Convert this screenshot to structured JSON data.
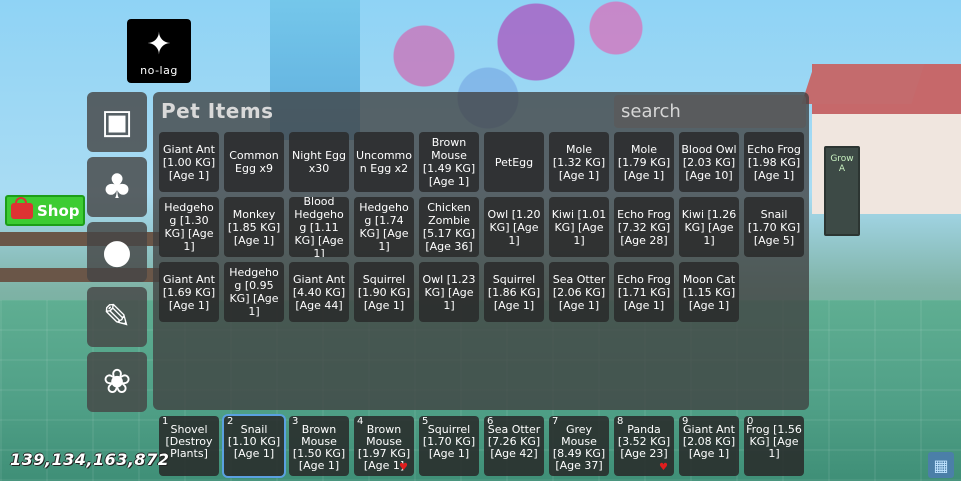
{
  "logo": {
    "text": "no-lag",
    "icon": "butterfly-icon"
  },
  "shop": {
    "label": "Shop",
    "icon": "basket-icon"
  },
  "side_menu": [
    {
      "icon": "box-icon",
      "glyph": "▣"
    },
    {
      "icon": "sprout-icon",
      "glyph": "🌱"
    },
    {
      "icon": "tomato-icon",
      "glyph": "🍅"
    },
    {
      "icon": "wrench-icon",
      "glyph": "🔧"
    },
    {
      "icon": "paw-icon",
      "glyph": "🐾"
    }
  ],
  "panel": {
    "title": "Pet Items",
    "search_placeholder": "search",
    "items": [
      "Giant Ant [1.00 KG] [Age 1]",
      "Common Egg x9",
      "Night Egg x30",
      "Uncommon Egg x2",
      "Brown Mouse [1.49 KG] [Age 1]",
      "PetEgg",
      "Mole [1.32 KG] [Age 1]",
      "Mole [1.79 KG] [Age 1]",
      "Blood Owl [2.03 KG] [Age 10]",
      "Echo Frog [1.98 KG] [Age 1]",
      "Hedgehog [1.30 KG] [Age 1]",
      "Monkey [1.85 KG] [Age 1]",
      "Blood Hedgehog [1.11 KG] [Age 1]",
      "Hedgehog [1.74 KG] [Age 1]",
      "Chicken Zombie [5.17 KG] [Age 36]",
      "Owl [1.20 KG] [Age 1]",
      "Kiwi [1.01 KG] [Age 1]",
      "Echo Frog [7.32 KG] [Age 28]",
      "Kiwi [1.26 KG] [Age 1]",
      "Snail [1.70 KG] [Age 5]",
      "Giant Ant [1.69 KG] [Age 1]",
      "Hedgehog [0.95 KG] [Age 1]",
      "Giant Ant [4.40 KG] [Age 44]",
      "Squirrel [1.90 KG] [Age 1]",
      "Owl [1.23 KG] [Age 1]",
      "Squirrel [1.86 KG] [Age 1]",
      "Sea Otter [2.06 KG] [Age 1]",
      "Echo Frog [1.71 KG] [Age 1]",
      "Moon Cat [1.15 KG] [Age 1]"
    ]
  },
  "hotbar": [
    {
      "num": "1",
      "label": "Shovel [Destroy Plants]",
      "heart": false
    },
    {
      "num": "2",
      "label": "Snail [1.10 KG] [Age 1]",
      "heart": false,
      "selected": true
    },
    {
      "num": "3",
      "label": "Brown Mouse [1.50 KG] [Age 1]",
      "heart": false
    },
    {
      "num": "4",
      "label": "Brown Mouse [1.97 KG] [Age 1]",
      "heart": true
    },
    {
      "num": "5",
      "label": "Squirrel [1.70 KG] [Age 1]",
      "heart": false
    },
    {
      "num": "6",
      "label": "Sea Otter [7.26 KG] [Age 42]",
      "heart": false
    },
    {
      "num": "7",
      "label": "Grey Mouse [8.49 KG] [Age 37]",
      "heart": false
    },
    {
      "num": "8",
      "label": "Panda [3.52 KG] [Age 23]",
      "heart": true
    },
    {
      "num": "9",
      "label": "Giant Ant [2.08 KG] [Age 1]",
      "heart": false
    },
    {
      "num": "0",
      "label": "Frog [1.56 KG] [Age 1]",
      "heart": false
    }
  ],
  "money": "139,134,163,872",
  "house_sign": "Grow A",
  "corner_icon": "backpack-icon",
  "colors": {
    "shop_green": "#3dcc33",
    "heart_red": "#e01e1e",
    "selected_blue": "#5aa0e0"
  }
}
